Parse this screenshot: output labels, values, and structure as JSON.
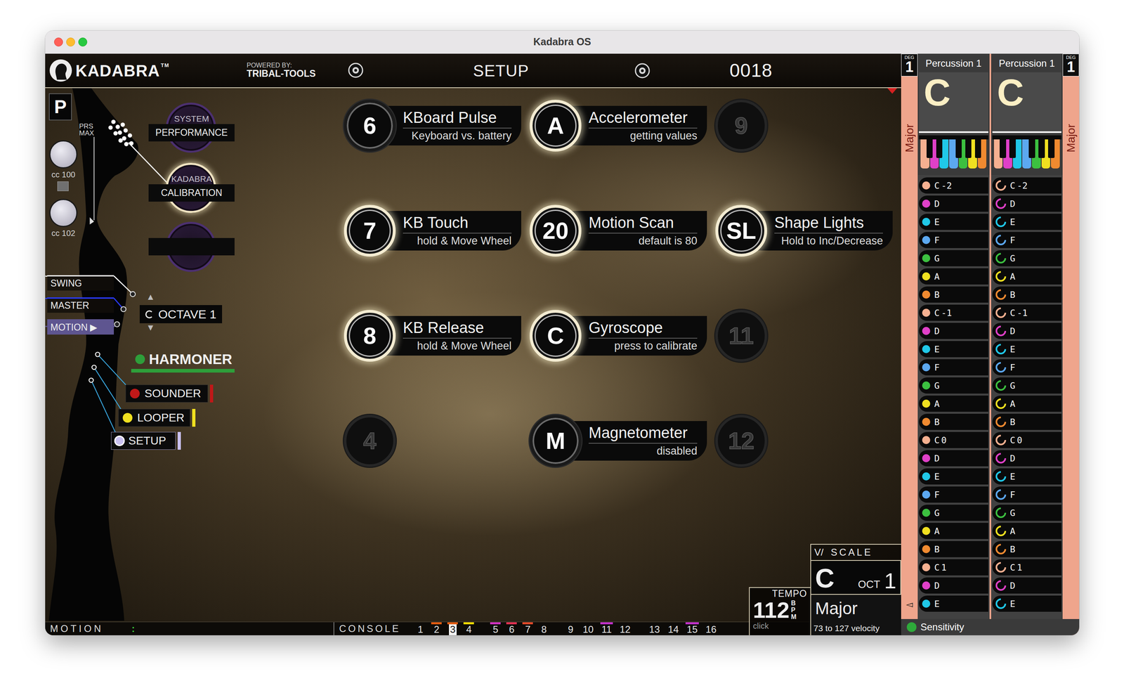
{
  "window": {
    "title": "Kadabra OS"
  },
  "header": {
    "logo": "KADABRA",
    "trademark": "TM",
    "powered_by": "POWERED BY:",
    "brand": "TRIBAL-TOOLS",
    "title": "SETUP",
    "counter": "0018"
  },
  "left_panel": {
    "preset": "P",
    "prs": "PRS",
    "max": "MAX",
    "knobs": [
      {
        "label": "cc 100"
      },
      {
        "label": "cc 102"
      }
    ],
    "menu_buttons": [
      {
        "caption": "SYSTEM",
        "label": "PERFORMANCE",
        "selected": false
      },
      {
        "caption": "KADABRA",
        "label": "CALIBRATION",
        "selected": true
      }
    ],
    "sliders": [
      {
        "label": "SWING",
        "kind": "line",
        "color": "#ffffff"
      },
      {
        "label": "MASTER",
        "kind": "line",
        "color": "#2a3cff"
      },
      {
        "label": "MOTION ▶",
        "kind": "box",
        "color": "#5e5590"
      }
    ],
    "octave": {
      "label": "OCTAVE 1",
      "up": "▲",
      "down": "▼"
    },
    "modules": [
      {
        "label": "HARMONER",
        "kind": "header",
        "color": "#2e9e3a",
        "selected": false
      },
      {
        "label": "SOUNDER",
        "kind": "box",
        "color": "#c01818",
        "selected": false
      },
      {
        "label": "LOOPER",
        "kind": "box",
        "color": "#f0e020",
        "selected": false
      },
      {
        "label": "SETUP",
        "kind": "box",
        "color": "#c8c0f0",
        "selected": true
      }
    ]
  },
  "tiles": [
    {
      "glyph": "6",
      "title": "KBoard Pulse",
      "subtitle": "Keyboard vs. battery",
      "kind": "plain"
    },
    {
      "glyph": "A",
      "title": "Accelerometer",
      "subtitle": "getting values",
      "kind": "glow"
    },
    {
      "glyph": "9",
      "kind": "empty"
    },
    {
      "glyph": "7",
      "title": "KB Touch",
      "subtitle": "hold & Move Wheel",
      "kind": "glow"
    },
    {
      "glyph": "20",
      "title": "Motion Scan",
      "subtitle": "default is 80",
      "kind": "glow"
    },
    {
      "glyph": "SL",
      "title": "Shape Lights",
      "subtitle": "Hold to Inc/Decrease",
      "kind": "glow"
    },
    {
      "glyph": "8",
      "title": "KB Release",
      "subtitle": "hold & Move Wheel",
      "kind": "glow"
    },
    {
      "glyph": "C",
      "title": "Gyroscope",
      "subtitle": "press to calibrate",
      "kind": "glow"
    },
    {
      "glyph": "11",
      "kind": "empty"
    },
    {
      "glyph": "4",
      "kind": "empty"
    },
    {
      "glyph": "M",
      "title": "Magnetometer",
      "subtitle": "disabled",
      "kind": "plain"
    },
    {
      "glyph": "12",
      "kind": "empty"
    }
  ],
  "scale": {
    "prefix": "V/",
    "label": "SCALE",
    "key": "C",
    "oct_label": "OCT",
    "oct": "1",
    "mode": "Major",
    "velocity": "73 to 127 velocity"
  },
  "tempo": {
    "label": "TEMPO",
    "bpm": "112",
    "unit": "BPM",
    "click": "click"
  },
  "status_bar": {
    "motion": "MOTION",
    "motion_indicator": ":",
    "console": "CONSOLE",
    "channels": [
      {
        "label": "1",
        "selected": false
      },
      {
        "label": "2",
        "selected": false,
        "color": "#e05a10"
      },
      {
        "label": "3",
        "selected": true,
        "color": "#e05a10"
      },
      {
        "label": "4",
        "selected": false,
        "color": "#f0d800"
      },
      {
        "label": "5",
        "selected": false,
        "color": "#d030c0"
      },
      {
        "label": "6",
        "selected": false,
        "color": "#e03050"
      },
      {
        "label": "7",
        "selected": false,
        "color": "#e04828"
      },
      {
        "label": "8",
        "selected": false
      },
      {
        "label": "9",
        "selected": false
      },
      {
        "label": "10",
        "selected": false
      },
      {
        "label": "11",
        "selected": false,
        "color": "#c030c8"
      },
      {
        "label": "12",
        "selected": false
      },
      {
        "label": "13",
        "selected": false
      },
      {
        "label": "14",
        "selected": false
      },
      {
        "label": "15",
        "selected": false,
        "color": "#c030c8"
      },
      {
        "label": "16",
        "selected": false
      }
    ]
  },
  "right_panel": {
    "columns": [
      {
        "deg_label": "DEG",
        "deg": "1",
        "instrument": "Percussion 1",
        "key": "C",
        "mode": "Major"
      },
      {
        "deg_label": "DEG",
        "deg": "1",
        "instrument": "Percussion 1",
        "key": "C",
        "mode": "Major"
      }
    ],
    "notes": [
      {
        "name": "C",
        "octave": "-2",
        "color": "#f5b090"
      },
      {
        "name": "D",
        "color": "#e040c8"
      },
      {
        "name": "E",
        "color": "#20c8e8"
      },
      {
        "name": "F",
        "color": "#5ca8f0"
      },
      {
        "name": "G",
        "color": "#3cc040"
      },
      {
        "name": "A",
        "color": "#f0e020"
      },
      {
        "name": "B",
        "color": "#f08a30"
      },
      {
        "name": "C",
        "octave": "-1",
        "color": "#f5b090"
      },
      {
        "name": "D",
        "color": "#e040c8"
      },
      {
        "name": "E",
        "color": "#20c8e8"
      },
      {
        "name": "F",
        "color": "#5ca8f0"
      },
      {
        "name": "G",
        "color": "#3cc040"
      },
      {
        "name": "A",
        "color": "#f0e020"
      },
      {
        "name": "B",
        "color": "#f08a30"
      },
      {
        "name": "C",
        "octave": "0",
        "color": "#f5b090"
      },
      {
        "name": "D",
        "color": "#e040c8"
      },
      {
        "name": "E",
        "color": "#20c8e8"
      },
      {
        "name": "F",
        "color": "#5ca8f0"
      },
      {
        "name": "G",
        "color": "#3cc040"
      },
      {
        "name": "A",
        "color": "#f0e020"
      },
      {
        "name": "B",
        "color": "#f08a30"
      },
      {
        "name": "C",
        "octave": "1",
        "color": "#f5b090"
      },
      {
        "name": "D",
        "color": "#e040c8"
      },
      {
        "name": "E",
        "color": "#20c8e8"
      }
    ],
    "pointer": "◅",
    "sensitivity": "Sensitivity"
  }
}
